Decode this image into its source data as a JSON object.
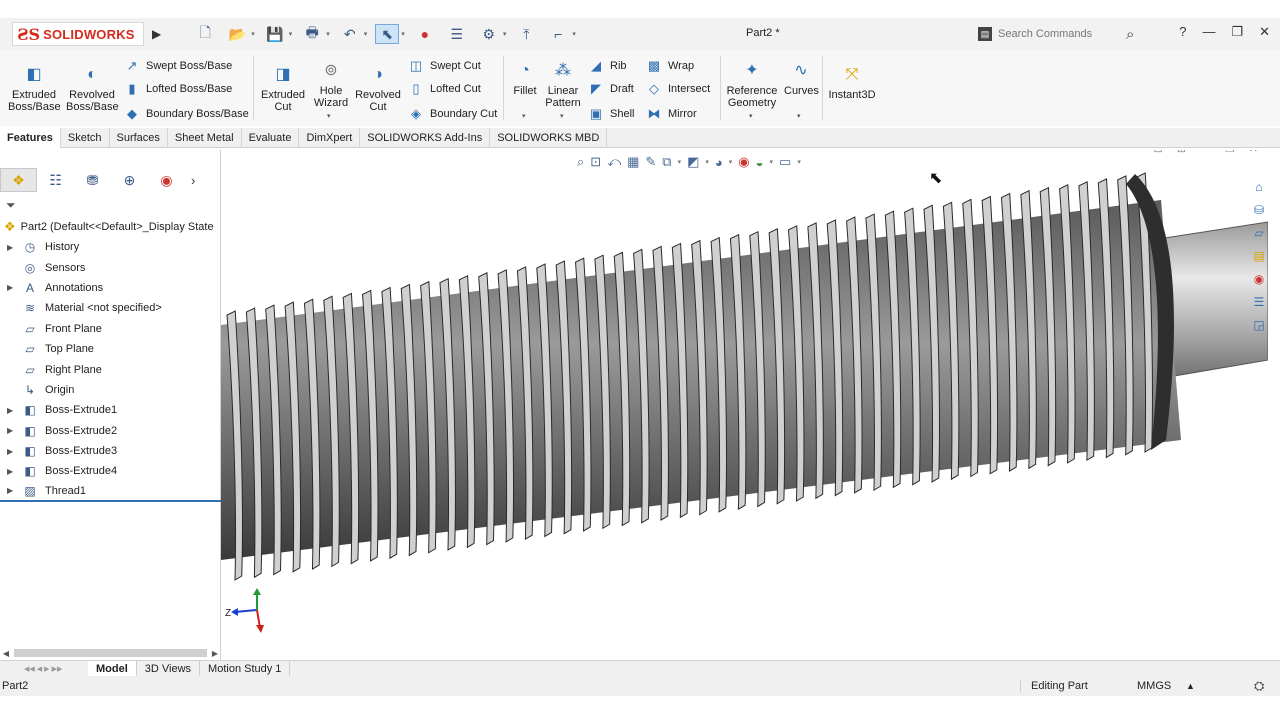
{
  "app": {
    "brand": "SOLIDWORKS",
    "doc_title": "Part2 *",
    "search_placeholder": "Search Commands",
    "help": "?"
  },
  "ribbon": {
    "extruded_boss": "Extruded Boss/Base",
    "revolved_boss": "Revolved Boss/Base",
    "swept_boss": "Swept Boss/Base",
    "lofted_boss": "Lofted Boss/Base",
    "boundary_boss": "Boundary Boss/Base",
    "extruded_cut": "Extruded Cut",
    "hole_wizard": "Hole Wizard",
    "revolved_cut": "Revolved Cut",
    "swept_cut": "Swept Cut",
    "lofted_cut": "Lofted Cut",
    "boundary_cut": "Boundary Cut",
    "fillet": "Fillet",
    "linear_pattern": "Linear Pattern",
    "rib": "Rib",
    "draft": "Draft",
    "shell": "Shell",
    "wrap": "Wrap",
    "intersect": "Intersect",
    "mirror": "Mirror",
    "reference_geometry": "Reference Geometry",
    "curves": "Curves",
    "instant3d": "Instant3D"
  },
  "tabs": [
    "Features",
    "Sketch",
    "Surfaces",
    "Sheet Metal",
    "Evaluate",
    "DimXpert",
    "SOLIDWORKS Add-Ins",
    "SOLIDWORKS MBD"
  ],
  "tree": {
    "root": "Part2  (Default<<Default>_Display State",
    "items": [
      {
        "label": "History",
        "icon": "history-icon",
        "expandable": true
      },
      {
        "label": "Sensors",
        "icon": "sensors-icon",
        "expandable": false
      },
      {
        "label": "Annotations",
        "icon": "annotations-icon",
        "expandable": true
      },
      {
        "label": "Material <not specified>",
        "icon": "material-icon",
        "expandable": false
      },
      {
        "label": "Front Plane",
        "icon": "plane-icon",
        "expandable": false
      },
      {
        "label": "Top Plane",
        "icon": "plane-icon",
        "expandable": false
      },
      {
        "label": "Right Plane",
        "icon": "plane-icon",
        "expandable": false
      },
      {
        "label": "Origin",
        "icon": "origin-icon",
        "expandable": false
      },
      {
        "label": "Boss-Extrude1",
        "icon": "extrude-feature-icon",
        "expandable": true
      },
      {
        "label": "Boss-Extrude2",
        "icon": "extrude-feature-icon",
        "expandable": true
      },
      {
        "label": "Boss-Extrude3",
        "icon": "extrude-feature-icon",
        "expandable": true
      },
      {
        "label": "Boss-Extrude4",
        "icon": "extrude-feature-icon",
        "expandable": true
      },
      {
        "label": "Thread1",
        "icon": "thread-feature-icon",
        "expandable": true
      }
    ]
  },
  "bottom_tabs": [
    "Model",
    "3D Views",
    "Motion Study 1"
  ],
  "status": {
    "doc": "Part2",
    "mode": "Editing Part",
    "units": "MMGS"
  },
  "triad": {
    "z_label": "Z"
  },
  "colors": {
    "brand_red": "#d52b1e",
    "accent_blue": "#2f6fb3",
    "thread_dark": "#3c3c3c",
    "thread_light": "#c6c6c6"
  }
}
